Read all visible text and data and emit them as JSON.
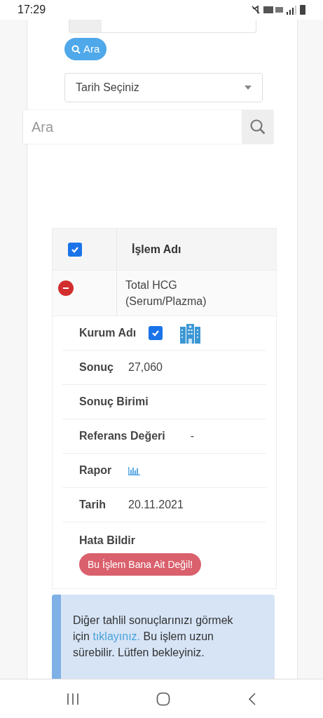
{
  "status_bar": {
    "time": "17:29"
  },
  "filters": {
    "search_button": "Ara",
    "date_select": "Tarih Seçiniz"
  },
  "search": {
    "placeholder": "Ara"
  },
  "table": {
    "header": {
      "checked": true,
      "column": "İşlem Adı"
    },
    "row": {
      "expanded": true,
      "name": "Total HCG (Serum/Plazma)"
    },
    "details": [
      {
        "kind": "institution",
        "label": "Kurum Adı",
        "checked": true
      },
      {
        "kind": "text",
        "label": "Sonuç",
        "value": "27,060"
      },
      {
        "kind": "text",
        "label": "Sonuç Birimi"
      },
      {
        "kind": "text",
        "label": "Referans Değeri",
        "value": "-"
      },
      {
        "kind": "report",
        "label": "Rapor"
      },
      {
        "kind": "text",
        "label": "Tarih",
        "value": "20.11.2021"
      },
      {
        "kind": "action",
        "label": "Hata Bildir",
        "button": "Bu İşlem Bana Ait Değil!"
      }
    ]
  },
  "notice": {
    "before": "Diğer tahlil sonuçlarınızı görmek için",
    "link": "tıklayınız.",
    "after": "Bu işlem uzun sürebilir. Lütfen bekleyiniz."
  }
}
